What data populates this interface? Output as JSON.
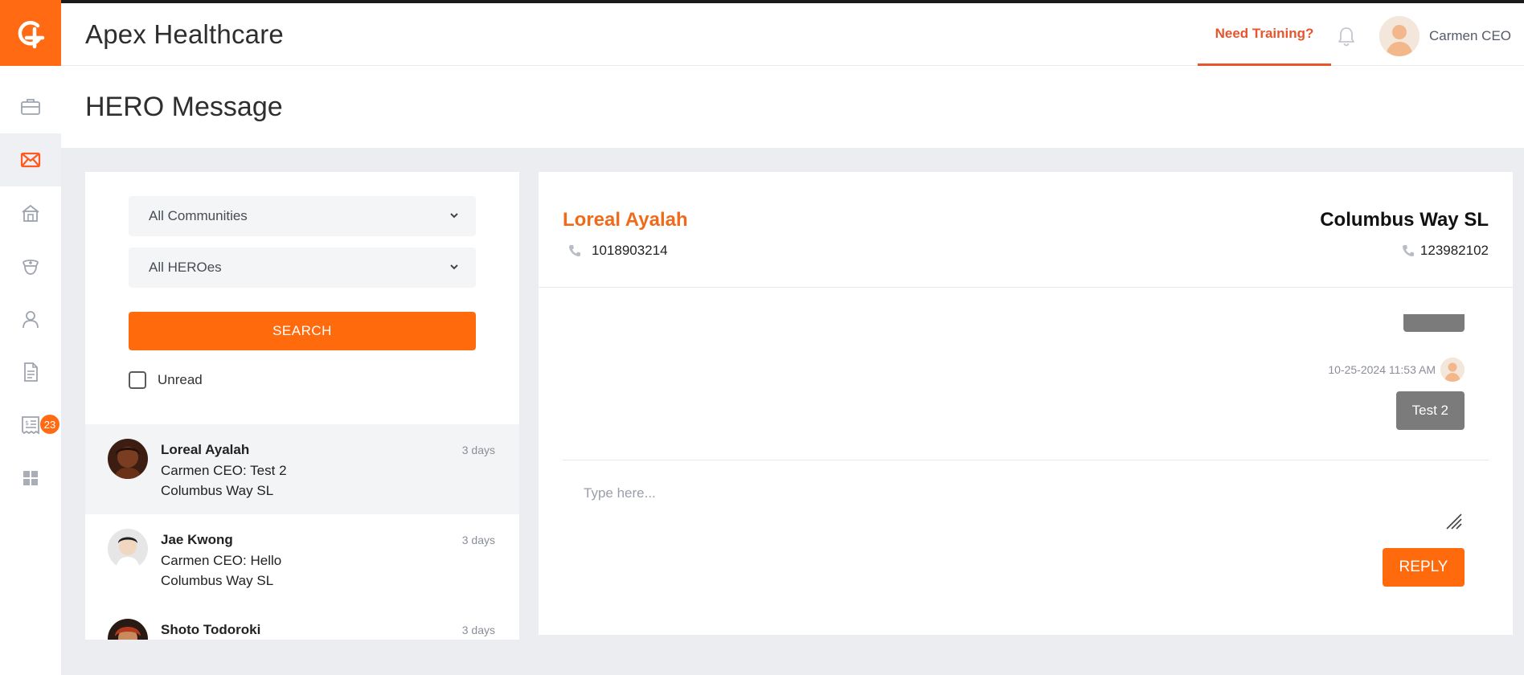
{
  "header": {
    "app_title": "Apex Healthcare",
    "need_training": "Need Training?",
    "user_name": "Carmen CEO",
    "logo_icon": "apex-plus-logo",
    "bell_icon": "bell-icon"
  },
  "sidebar": {
    "items": [
      {
        "icon": "briefcase-icon",
        "active": false
      },
      {
        "icon": "envelope-icon",
        "active": true
      },
      {
        "icon": "home-icon",
        "active": false
      },
      {
        "icon": "nurse-cap-icon",
        "active": false
      },
      {
        "icon": "user-icon",
        "active": false
      },
      {
        "icon": "document-icon",
        "active": false
      },
      {
        "icon": "receipt-icon",
        "active": false,
        "badge": "23"
      },
      {
        "icon": "grid-icon",
        "active": false
      }
    ]
  },
  "page": {
    "title": "HERO Message"
  },
  "filters": {
    "community": "All Communities",
    "hero": "All HEROes",
    "search_label": "SEARCH",
    "unread_label": "Unread"
  },
  "conversations": [
    {
      "name": "Loreal Ayalah",
      "time": "3 days",
      "line1": "Carmen CEO: Test 2",
      "line2": "Columbus Way SL"
    },
    {
      "name": "Jae Kwong",
      "time": "3 days",
      "line1": "Carmen CEO: Hello",
      "line2": "Columbus Way SL"
    },
    {
      "name": "Shoto Todoroki",
      "time": "3 days",
      "line1": "",
      "line2": ""
    }
  ],
  "thread": {
    "contact_name": "Loreal Ayalah",
    "contact_phone": "1018903214",
    "community_name": "Columbus Way SL",
    "community_phone": "123982102",
    "message_timestamp": "10-25-2024 11:53 AM",
    "message_text": "Test 2",
    "reply_placeholder": "Type here...",
    "reply_label": "REPLY"
  },
  "colors": {
    "accent": "#ff6a13",
    "accent_text": "#e8552b",
    "bubble": "#7b7b7b",
    "page_bg": "#ecedf1"
  }
}
